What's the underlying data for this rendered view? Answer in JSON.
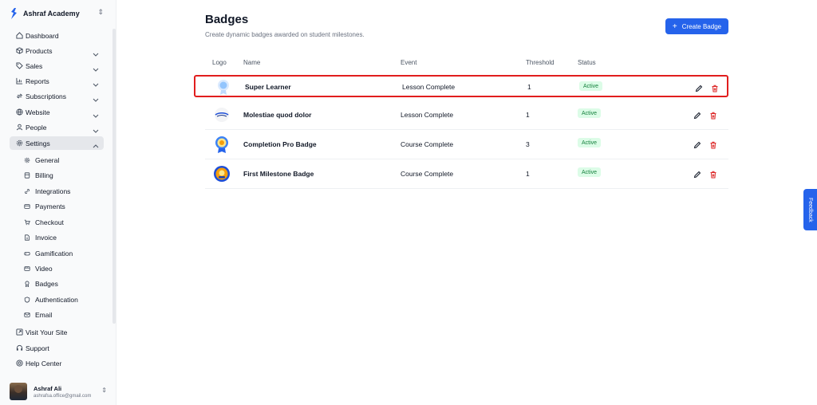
{
  "sidebar": {
    "brand": "Ashraf Academy",
    "nav": [
      {
        "label": "Dashboard"
      },
      {
        "label": "Products"
      },
      {
        "label": "Sales"
      },
      {
        "label": "Reports"
      },
      {
        "label": "Subscriptions"
      },
      {
        "label": "Website"
      },
      {
        "label": "People"
      },
      {
        "label": "Settings"
      }
    ],
    "settings_sub": [
      {
        "label": "General"
      },
      {
        "label": "Billing"
      },
      {
        "label": "Integrations"
      },
      {
        "label": "Payments"
      },
      {
        "label": "Checkout"
      },
      {
        "label": "Invoice"
      },
      {
        "label": "Gamification"
      },
      {
        "label": "Video"
      },
      {
        "label": "Badges"
      },
      {
        "label": "Authentication"
      },
      {
        "label": "Email"
      }
    ],
    "footer": [
      {
        "label": "Visit Your Site"
      },
      {
        "label": "Support"
      },
      {
        "label": "Help Center"
      }
    ],
    "user": {
      "name": "Ashraf Ali",
      "email": "ashrafsa.office@gmail.com"
    }
  },
  "main": {
    "title": "Badges",
    "subtitle": "Create dynamic badges awarded on student milestones.",
    "create_button": "Create Badge",
    "columns": {
      "logo": "Logo",
      "name": "Name",
      "event": "Event",
      "threshold": "Threshold",
      "status": "Status"
    },
    "rows": [
      {
        "name": "Super Learner",
        "event": "Lesson Complete",
        "threshold": "1",
        "status": "Active"
      },
      {
        "name": "Molestiae quod dolor",
        "event": "Lesson Complete",
        "threshold": "1",
        "status": "Active"
      },
      {
        "name": "Completion Pro Badge",
        "event": "Course Complete",
        "threshold": "3",
        "status": "Active"
      },
      {
        "name": "First Milestone Badge",
        "event": "Course Complete",
        "threshold": "1",
        "status": "Active"
      }
    ]
  },
  "feedback": "Feedback",
  "colors": {
    "accent": "#2563eb",
    "active_bg": "#dcfce7",
    "active_text": "#15803d",
    "highlight": "#e11d1d",
    "delete": "#dc2626"
  }
}
